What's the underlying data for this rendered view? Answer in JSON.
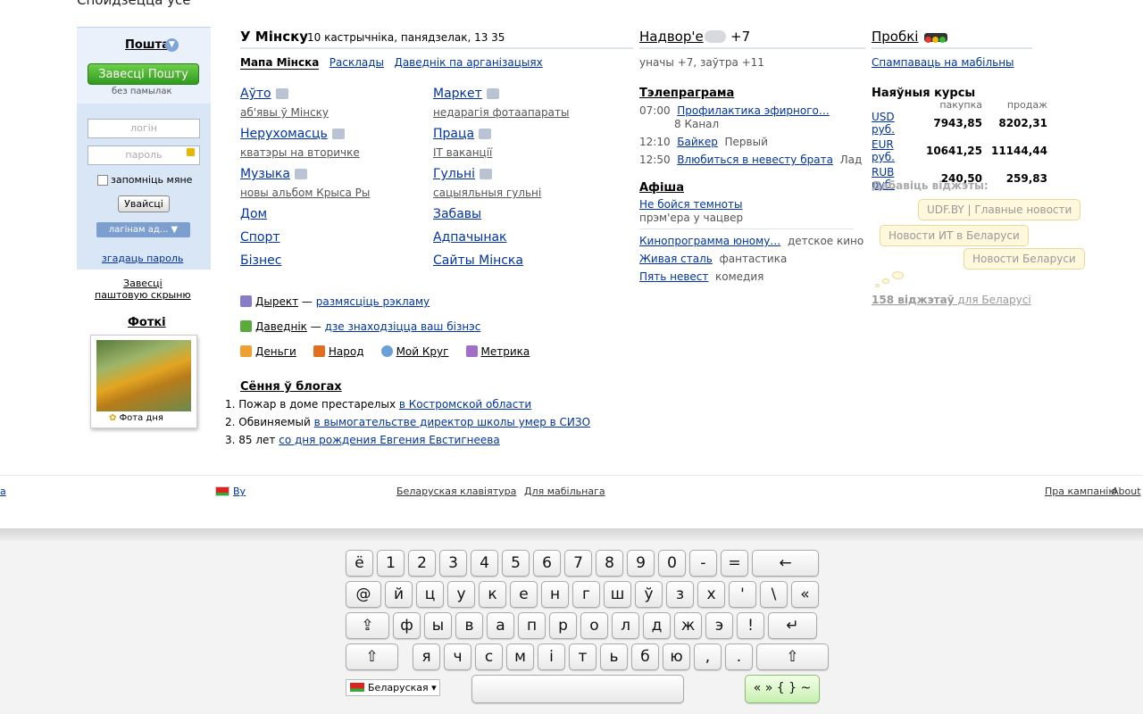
{
  "top_text": "Спойдзецца ўсё",
  "mail": {
    "title": "Пошта",
    "create_button": "Завесці Пошту",
    "no_ads": "без памылак",
    "login_placeholder": "логін",
    "password_placeholder": "пароль",
    "remember": "запомніць мяне",
    "login_button": "Увайсці",
    "login_dropdown": "лагінам ад... ▼",
    "forgot": "згадаць пароль",
    "open_mail_line1": "Завесці",
    "open_mail_line2": "паштовую скрыню"
  },
  "photos": {
    "title": "Фоткі",
    "caption": "Фота дня"
  },
  "city": {
    "name": "У Мінску",
    "date": "10 кастрычніка, панядзелак, 13 35",
    "nav": [
      "Мапа Мінска",
      "Расклады",
      "Даведнік па арганізацыях"
    ]
  },
  "services": [
    {
      "label": "Аўто",
      "sub": "аб'явы ў Мінску",
      "icon": "car-icon"
    },
    {
      "label": "Маркет",
      "sub": "недарагія фотаапараты",
      "icon": "market-icon"
    },
    {
      "label": "Нерухомасць",
      "sub": "кватэры на вторичке",
      "icon": "m2-icon"
    },
    {
      "label": "Праца",
      "sub": "IT ваканції",
      "icon": "chair-icon"
    },
    {
      "label": "Музыка",
      "sub": "новы альбом Крыса Ры",
      "icon": "speaker-icon"
    },
    {
      "label": "Гульні",
      "sub": "сацыяльныя гульні",
      "icon": "gamepad-icon"
    },
    {
      "label": "Дом"
    },
    {
      "label": "Забавы"
    },
    {
      "label": "Спорт"
    },
    {
      "label": "Адпачынак"
    },
    {
      "label": "Бізнес"
    },
    {
      "label": "Сайты Мінска"
    }
  ],
  "promo": {
    "direct": "Дырект",
    "direct_link": "размясціць рэкламу",
    "directory": "Даведнік",
    "directory_link": "дзе знаходзіцца ваш бізнэс",
    "dash": "—",
    "bottom": [
      "Деньги",
      "Народ",
      "Мой Круг",
      "Метрика"
    ]
  },
  "blogs": {
    "title": "Сёння ў блогах",
    "items": [
      {
        "num": "1.",
        "text": "Пожар в доме престарелых ",
        "link": "в Костромской области"
      },
      {
        "num": "2.",
        "text": "Обвиняемый ",
        "link": "в вымогательстве директор школы умер в СИЗО"
      },
      {
        "num": "3.",
        "text": "85 лет ",
        "link": "со дня рождения Евгения Евстигнеева"
      }
    ]
  },
  "weather": {
    "title": "Надвор'е",
    "temp": "+7",
    "sub": "уначы +7,  заўтра +11"
  },
  "tv": {
    "title": "Тэлепраграма",
    "items": [
      {
        "time": "07:00",
        "show": "Профилактика эфирного…",
        "channel": "8 Канал"
      },
      {
        "time": "12:10",
        "show": "Байкер",
        "channel": "Первый"
      },
      {
        "time": "12:50",
        "show": "Влюбиться в невесту брата",
        "channel": "Лад"
      }
    ]
  },
  "afisha": {
    "title": "Афіша",
    "feature": "Не бойся темноты",
    "feature_sub": "прэм'ера у чацвер",
    "items": [
      {
        "link": "Кинопрограмма юному…",
        "genre": "детское кино"
      },
      {
        "link": "Живая сталь",
        "genre": "фантастика"
      },
      {
        "link": "Пять невест",
        "genre": "комедия"
      }
    ]
  },
  "traffic": {
    "title": "Пробкі",
    "mobile": "Спампаваць на мабільны"
  },
  "rates": {
    "title": "Наяўныя курсы",
    "buy_label": "пакупка",
    "sell_label": "продаж",
    "rows": [
      {
        "cur": "USD руб.",
        "buy": "7943,85",
        "sell": "8202,31"
      },
      {
        "cur": "EUR руб.",
        "buy": "10641,25",
        "sell": "11144,44"
      },
      {
        "cur": "RUB руб.",
        "buy": "240,50",
        "sell": "259,83"
      }
    ]
  },
  "widgets": {
    "title": "Дабавіць віджэты:",
    "bubbles": [
      "UDF.BY | Главные новости",
      "Новости ИТ в Беларуси",
      "Новости Беларуси"
    ],
    "count": "158 віджэтаў",
    "count_suffix": " для Беларусі"
  },
  "footer": {
    "left_cut": "а",
    "region": "By",
    "keyboard": "Беларуская клавіятура",
    "mobile": "Для мабільнага",
    "about_company": "Пра кампанію",
    "about": "About"
  },
  "keyboard": {
    "row1": [
      "ё",
      "1",
      "2",
      "3",
      "4",
      "5",
      "6",
      "7",
      "8",
      "9",
      "0",
      "-",
      "=",
      "←"
    ],
    "row2": [
      "@",
      "й",
      "ц",
      "у",
      "к",
      "е",
      "н",
      "г",
      "ш",
      "ў",
      "з",
      "х",
      "'",
      "\\",
      "«"
    ],
    "row3": [
      "⇪",
      "ф",
      "ы",
      "в",
      "а",
      "п",
      "р",
      "о",
      "л",
      "д",
      "ж",
      "э",
      "!",
      "↵"
    ],
    "row4": [
      "⇧",
      "я",
      "ч",
      "с",
      "м",
      "і",
      "т",
      "ь",
      "б",
      "ю",
      ",",
      ".",
      "⇧"
    ],
    "language": "Беларуская ▾",
    "symbols": "« » { } ~"
  },
  "colors": {
    "link": "#0033aa",
    "mail_bg": "#d9e6f6",
    "green_button": "#2f9a1e",
    "widget_bubble": "#fff8dc"
  }
}
